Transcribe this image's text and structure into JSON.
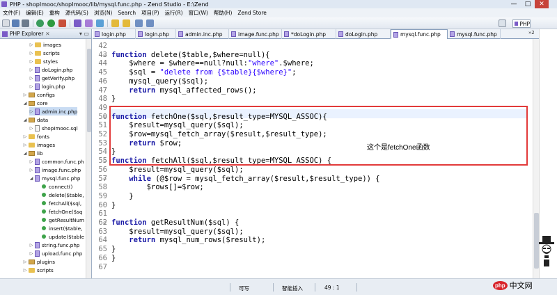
{
  "window": {
    "title": "PHP - shopImooc/shopImooc/lib/mysql.func.php - Zend Studio - E:\\Zend",
    "min": "—",
    "max": "□",
    "close": "✕"
  },
  "menu": [
    "文件(F)",
    "编辑(E)",
    "重构",
    "源代码(S)",
    "浏览(N)",
    "Search",
    "项目(P)",
    "运行(R)",
    "窗口(W)",
    "帮助(H)",
    "Zend Store"
  ],
  "toolbar": {
    "perspective_label": "PHP"
  },
  "explorer": {
    "title": "PHP Explorer",
    "items": [
      {
        "label": "images",
        "type": "folder",
        "indent": 1
      },
      {
        "label": "scripts",
        "type": "folder",
        "indent": 1
      },
      {
        "label": "styles",
        "type": "folder",
        "indent": 1
      },
      {
        "label": "doLogin.php",
        "type": "file",
        "indent": 1
      },
      {
        "label": "getVerify.php",
        "type": "file",
        "indent": 1
      },
      {
        "label": "login.php",
        "type": "file",
        "indent": 1
      },
      {
        "label": "configs",
        "type": "pfolder",
        "indent": 0
      },
      {
        "label": "core",
        "type": "pfolder",
        "indent": 0
      },
      {
        "label": "admin.inc.php",
        "type": "file",
        "indent": 1
      },
      {
        "label": "data",
        "type": "pfolder",
        "indent": 0
      },
      {
        "label": "shopImooc.sql",
        "type": "sql",
        "indent": 1
      },
      {
        "label": "fonts",
        "type": "folder",
        "indent": 0
      },
      {
        "label": "images",
        "type": "folder",
        "indent": 0
      },
      {
        "label": "lib",
        "type": "pfolder",
        "indent": 0
      },
      {
        "label": "common.func.ph",
        "type": "file",
        "indent": 1
      },
      {
        "label": "image.func.php",
        "type": "file",
        "indent": 1
      },
      {
        "label": "mysql.func.php",
        "type": "file",
        "indent": 1
      },
      {
        "label": "connect()",
        "type": "fn",
        "indent": 2
      },
      {
        "label": "delete($table,",
        "type": "fn",
        "indent": 2
      },
      {
        "label": "fetchAll($sql,",
        "type": "fn",
        "indent": 2
      },
      {
        "label": "fetchOne($sq",
        "type": "fn",
        "indent": 2
      },
      {
        "label": "getResultNum",
        "type": "fn",
        "indent": 2
      },
      {
        "label": "insert($table,",
        "type": "fn",
        "indent": 2
      },
      {
        "label": "update($table",
        "type": "fn",
        "indent": 2
      },
      {
        "label": "string.func.php",
        "type": "file",
        "indent": 1
      },
      {
        "label": "upload.func.php",
        "type": "file",
        "indent": 1
      },
      {
        "label": "plugins",
        "type": "pfolder",
        "indent": 0
      },
      {
        "label": "scripts",
        "type": "folder",
        "indent": 0
      }
    ]
  },
  "tabs": [
    {
      "label": "login.php"
    },
    {
      "label": "login.php"
    },
    {
      "label": "admin.inc.php"
    },
    {
      "label": "image.func.php"
    },
    {
      "label": "*doLogin.php"
    },
    {
      "label": "doLogin.php"
    },
    {
      "label": "mysql.func.php",
      "active": true
    },
    {
      "label": "mysql.func.php"
    }
  ],
  "tabs_overflow": "»2",
  "editor": {
    "lines": [
      {
        "n": "42",
        "code": ""
      },
      {
        "n": "43",
        "code": "function delete($table,$where=null){"
      },
      {
        "n": "44",
        "code": "    $where = $where==null?null:\"where\".$where;"
      },
      {
        "n": "45",
        "code": "    $sql = \"delete from {$table}{$where}\";"
      },
      {
        "n": "46",
        "code": "    mysql_query($sql);"
      },
      {
        "n": "47",
        "code": "    return mysql_affected_rows();"
      },
      {
        "n": "48",
        "code": "}"
      },
      {
        "n": "49",
        "code": ""
      },
      {
        "n": "50",
        "code": "function fetchOne($sql,$result_type=MYSQL_ASSOC){"
      },
      {
        "n": "51",
        "code": "    $result=mysql_query($sql);"
      },
      {
        "n": "52",
        "code": "    $row=mysql_fetch_array($result,$result_type);"
      },
      {
        "n": "53",
        "code": "    return $row;"
      },
      {
        "n": "54",
        "code": "}"
      },
      {
        "n": "55",
        "code": "function fetchAll($sql,$result_type=MYSQL_ASSOC) {"
      },
      {
        "n": "56",
        "code": "    $result=mysql_query($sql);"
      },
      {
        "n": "57",
        "code": "    while (@$row = mysql_fetch_array($result,$result_type)) {"
      },
      {
        "n": "58",
        "code": "        $rows[]=$row;"
      },
      {
        "n": "59",
        "code": "    }"
      },
      {
        "n": "60",
        "code": "}"
      },
      {
        "n": "61",
        "code": ""
      },
      {
        "n": "62",
        "code": "function getResultNum($sql) {"
      },
      {
        "n": "63",
        "code": "    $result=mysql_query($sql);"
      },
      {
        "n": "64",
        "code": "    return mysql_num_rows($result);"
      },
      {
        "n": "65",
        "code": "}"
      },
      {
        "n": "66",
        "code": "}"
      },
      {
        "n": "67",
        "code": ""
      }
    ],
    "annotation": "这个是fetchOne函数"
  },
  "status": {
    "writable": "可写",
    "insert_mode": "智能插入",
    "position": "49 : 1"
  },
  "watermark": {
    "badge": "php",
    "text": "中文网"
  },
  "colors": {
    "keyword": "#1a1aa6",
    "string": "#2a00ff",
    "highlight": "#e23a3a",
    "accent": "#7a5bc7"
  }
}
